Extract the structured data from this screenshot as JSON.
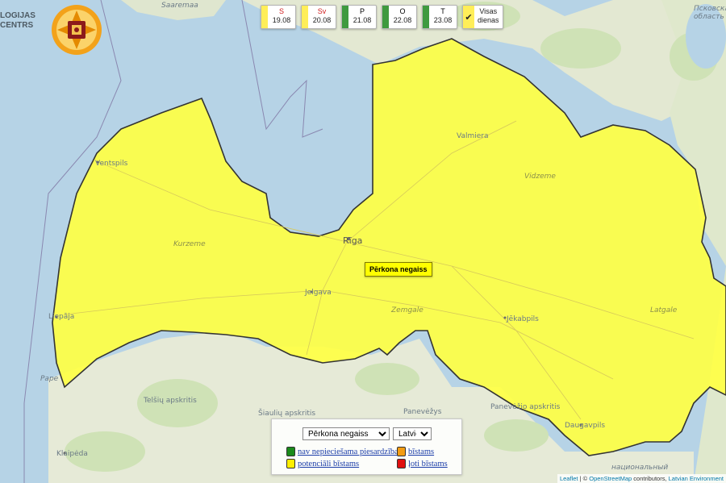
{
  "logo": {
    "text_line1": "LOGIJAS",
    "text_line2": "CENTRS",
    "emblem": "fire-rescue-emblem-icon"
  },
  "days": [
    {
      "name": "S",
      "date": "19.08",
      "color": "#ffee58",
      "weekend": true
    },
    {
      "name": "Sv",
      "date": "20.08",
      "color": "#ffee58",
      "weekend": true
    },
    {
      "name": "P",
      "date": "21.08",
      "color": "#3f9a3f",
      "weekend": false
    },
    {
      "name": "O",
      "date": "22.08",
      "color": "#3f9a3f",
      "weekend": false
    },
    {
      "name": "T",
      "date": "23.08",
      "color": "#3f9a3f",
      "weekend": false
    }
  ],
  "all_days": {
    "line1": "Visas",
    "line2": "dienas",
    "check": "checkmark-icon"
  },
  "warning_label": "Pērkona negaiss",
  "warning_color": "#ffff00",
  "place_labels": {
    "saaremaa": "Saaremaa",
    "ventspils": "Ventspils",
    "riga": "Rīga",
    "valmiera": "Valmiera",
    "jelgava": "Jelgava",
    "liepaja": "Liepāja",
    "jekabpils": "Jēkabpils",
    "daugavpils": "Daugavpils",
    "panevezys": "Panevėžys",
    "klaipeda": "Klaipėda",
    "pape": "Pape",
    "pskov_top": "Псковская",
    "pskov_top2": "область",
    "natpark_bottom": "национальный",
    "telsiai": "Telšių apskritis",
    "siauliai": "Šiaulių apskritis",
    "panevezys_region": "Panevėžio apskritis",
    "kurzeme": "Kurzeme",
    "zemgale": "Zemgale",
    "vidzeme": "Vidzeme",
    "latgale": "Latgale"
  },
  "legend": {
    "hazard_select": {
      "selected": "Pērkona negaiss"
    },
    "language_select": {
      "selected": "Latviešu"
    },
    "items": [
      {
        "label": "nav nepieciešama piesardzība",
        "color": "#1a8a1a"
      },
      {
        "label": "bīstams",
        "color": "#f39c12"
      },
      {
        "label": "potenciāli bīstams",
        "color": "#ffee00"
      },
      {
        "label": "ļoti bīstams",
        "color": "#e01010"
      }
    ]
  },
  "attribution": {
    "leaflet": "Leaflet",
    "sep1": " | © ",
    "osm": "OpenStreetMap",
    "contrib": " contributors, ",
    "latvian_env": "Latvian Environment"
  },
  "colors": {
    "sea": "#b6d3e6",
    "land": "#e9ecd9",
    "forest": "#cfe3b8",
    "warning_fill": "#ffff44",
    "border_line": "#333333"
  }
}
